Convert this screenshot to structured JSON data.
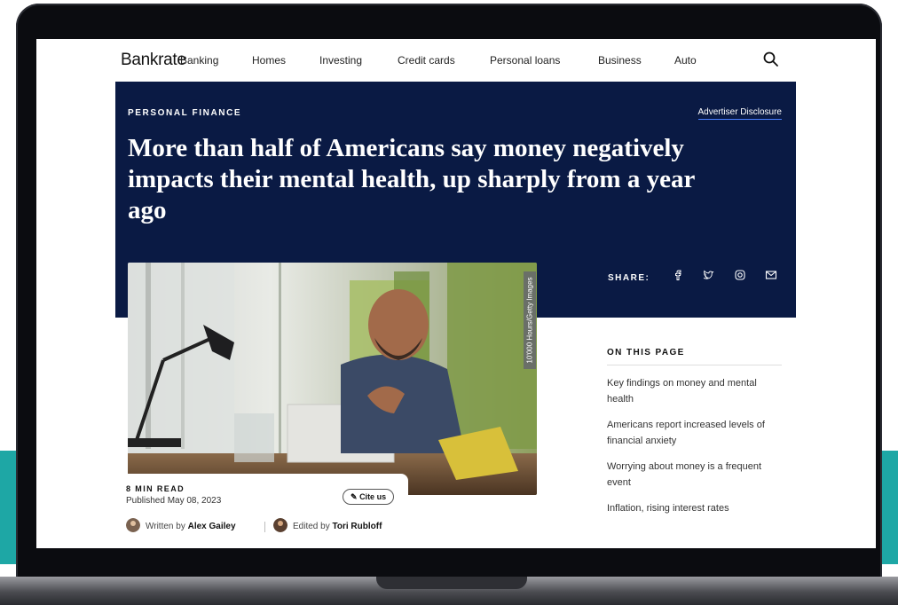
{
  "nav": {
    "logo": "Bankrate",
    "items": [
      "Banking",
      "Homes",
      "Investing",
      "Credit cards",
      "Personal loans",
      "Business",
      "Auto"
    ]
  },
  "hero": {
    "section_tag": "PERSONAL FINANCE",
    "disclosure": "Advertiser Disclosure",
    "headline": "More than half of Americans say money negatively impacts their mental health, up sharply from a year ago",
    "share_label": "SHARE:"
  },
  "photo": {
    "credit": "10'000 Hours/Getty Images"
  },
  "meta": {
    "read_time": "8 MIN READ",
    "published": "Published May 08, 2023",
    "cite_label": "Cite us",
    "written_prefix": "Written by",
    "author": "Alex Gailey",
    "edited_prefix": "Edited by",
    "editor": "Tori Rubloff"
  },
  "on_this_page": {
    "title": "ON THIS PAGE",
    "items": [
      "Key findings on money and mental health",
      "Americans report increased levels of financial anxiety",
      "Worrying about money is a frequent event",
      "Inflation, rising interest rates"
    ]
  },
  "colors": {
    "navy": "#0a1a44",
    "teal": "#1ea7a5",
    "link_underline": "#4a7fff"
  },
  "icons": [
    "search-icon",
    "facebook-icon",
    "twitter-icon",
    "instagram-icon",
    "email-icon",
    "pencil-icon"
  ]
}
